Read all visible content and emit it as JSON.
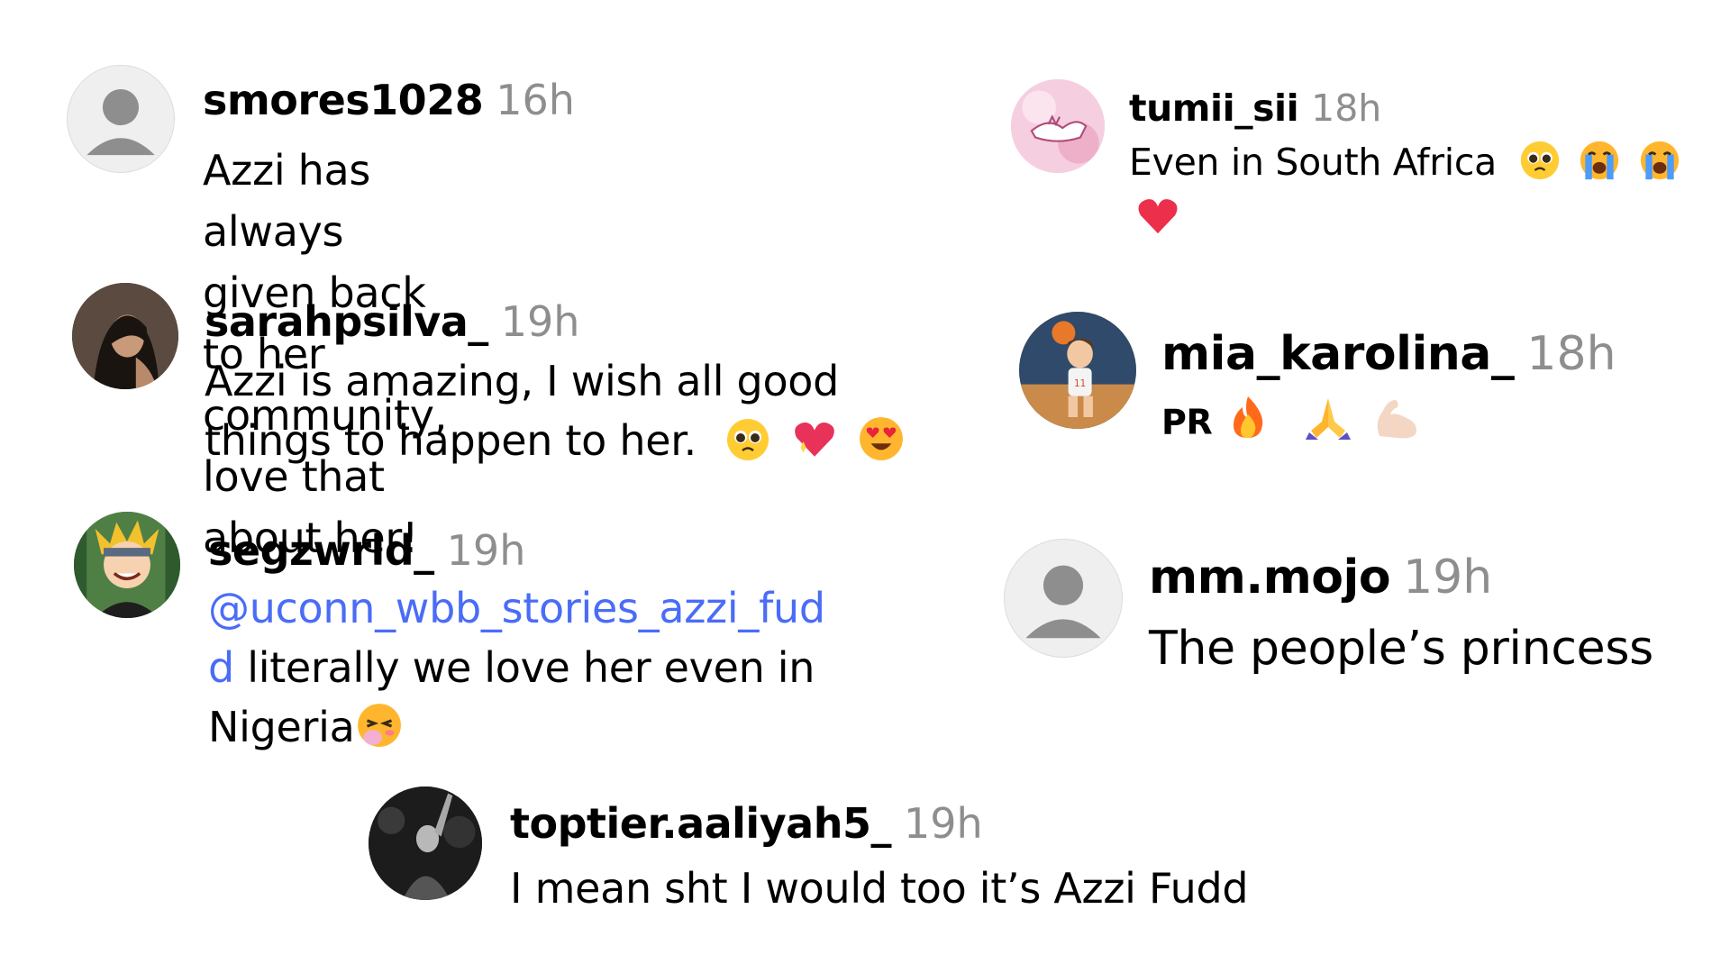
{
  "comments": [
    {
      "username": "smores1028",
      "time": "16h",
      "text_lines": [
        "Azzi has always given back to her",
        "community, love that about her!"
      ],
      "avatar": "default-avatar-icon"
    },
    {
      "username": "sarahpsilva_",
      "time": "19h",
      "text_lines": [
        "Azzi is amazing, I wish all good",
        "things to happen to her."
      ],
      "emojis": [
        "pleading-face-icon",
        "sparkling-heart-icon",
        "heart-eyes-icon"
      ],
      "avatar": "photo-avatar"
    },
    {
      "username": "segzwrld_",
      "time": "19h",
      "mention": "@uconn_wbb_stories_azzi_fud",
      "mention_cont": "d",
      "text_lines": [
        "literally we love her even in",
        "Nigeria"
      ],
      "emojis": [
        "blushing-giggle-icon"
      ],
      "avatar": "anime-avatar"
    },
    {
      "username": "tumii_sii",
      "time": "18h",
      "text_lines": [
        "Even in South Africa"
      ],
      "emojis": [
        "pleading-face-icon",
        "loudly-crying-face-icon",
        "loudly-crying-face-icon",
        "red-heart-icon"
      ],
      "avatar": "pink-art-avatar"
    },
    {
      "username": "mia_karolina_",
      "time": "18h",
      "text_lines": [
        "PR"
      ],
      "emojis": [
        "fire-icon",
        "folded-hands-icon",
        "flexed-biceps-icon"
      ],
      "avatar": "basketball-avatar"
    },
    {
      "username": "mm.mojo",
      "time": "19h",
      "text_lines": [
        "The people’s princess"
      ],
      "avatar": "default-avatar-icon"
    },
    {
      "username": "toptier.aaliyah5_",
      "time": "19h",
      "text_lines": [
        "I mean sht I would too it’s Azzi Fudd"
      ],
      "avatar": "dark-photo-avatar"
    }
  ],
  "colors": {
    "timestamp": "#8e8e8e",
    "mention": "#4a6cf7",
    "avatar_bg": "#eeeeee",
    "avatar_fg": "#8e8e8e"
  }
}
